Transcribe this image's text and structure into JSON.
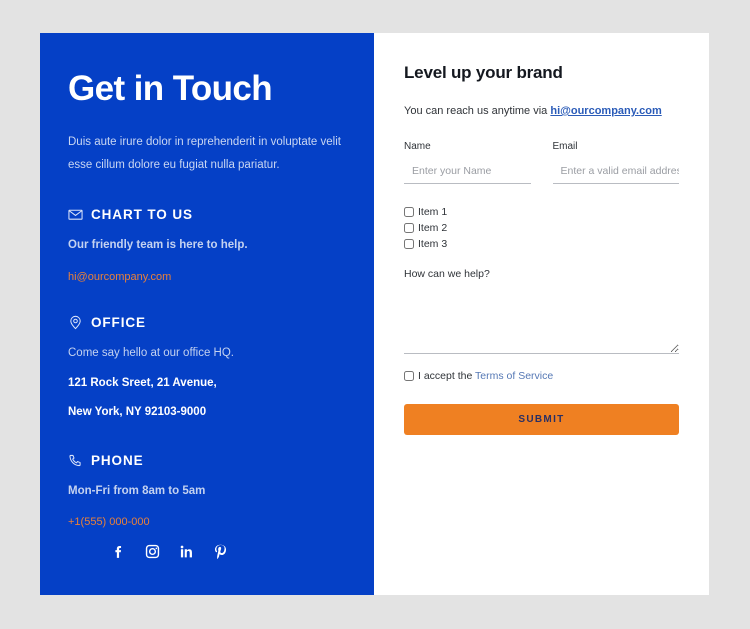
{
  "theme": {
    "panel_blue": "#0540c6",
    "page_bg": "#e3e3e3",
    "accent_orange": "#ef8022",
    "left_link_orange": "#e8803a",
    "link_blue": "#2a5bb8"
  },
  "left": {
    "headline": "Get in Touch",
    "intro": "Duis aute irure dolor in reprehenderit in voluptate velit esse cillum dolore eu fugiat nulla pariatur.",
    "sections": [
      {
        "icon": "envelope-icon",
        "title": "CHART TO US",
        "description": "Our friendly team is here to help.",
        "link": "hi@ourcompany.com"
      },
      {
        "icon": "map-pin-icon",
        "title": "OFFICE",
        "description": "Come say hello at our office HQ.",
        "address_line_1": "121 Rock Sreet, 21 Avenue,",
        "address_line_2": "New York, NY 92103-9000"
      },
      {
        "icon": "phone-icon",
        "title": "PHONE",
        "description": "Mon-Fri from 8am to 5am",
        "link": "+1(555) 000-000"
      }
    ],
    "socials": [
      {
        "name": "facebook-icon",
        "label": "Facebook"
      },
      {
        "name": "instagram-icon",
        "label": "Instagram"
      },
      {
        "name": "linkedin-icon",
        "label": "LinkedIn"
      },
      {
        "name": "pinterest-icon",
        "label": "Pinterest"
      }
    ]
  },
  "form": {
    "title": "Level up your brand",
    "reach_text": "You can reach us anytime via ",
    "reach_email": "hi@ourcompany.com",
    "name_label": "Name",
    "name_placeholder": "Enter your Name",
    "name_value": "",
    "email_label": "Email",
    "email_placeholder": "Enter a valid email address",
    "email_value": "",
    "checkboxes": [
      {
        "label": "Item 1",
        "checked": false
      },
      {
        "label": "Item 2",
        "checked": false
      },
      {
        "label": "Item 3",
        "checked": false
      }
    ],
    "message_label": "How can we help?",
    "message_value": "",
    "accept_text": "I accept the ",
    "accept_link": "Terms of Service",
    "accept_checked": false,
    "submit_label": "SUBMIT"
  }
}
